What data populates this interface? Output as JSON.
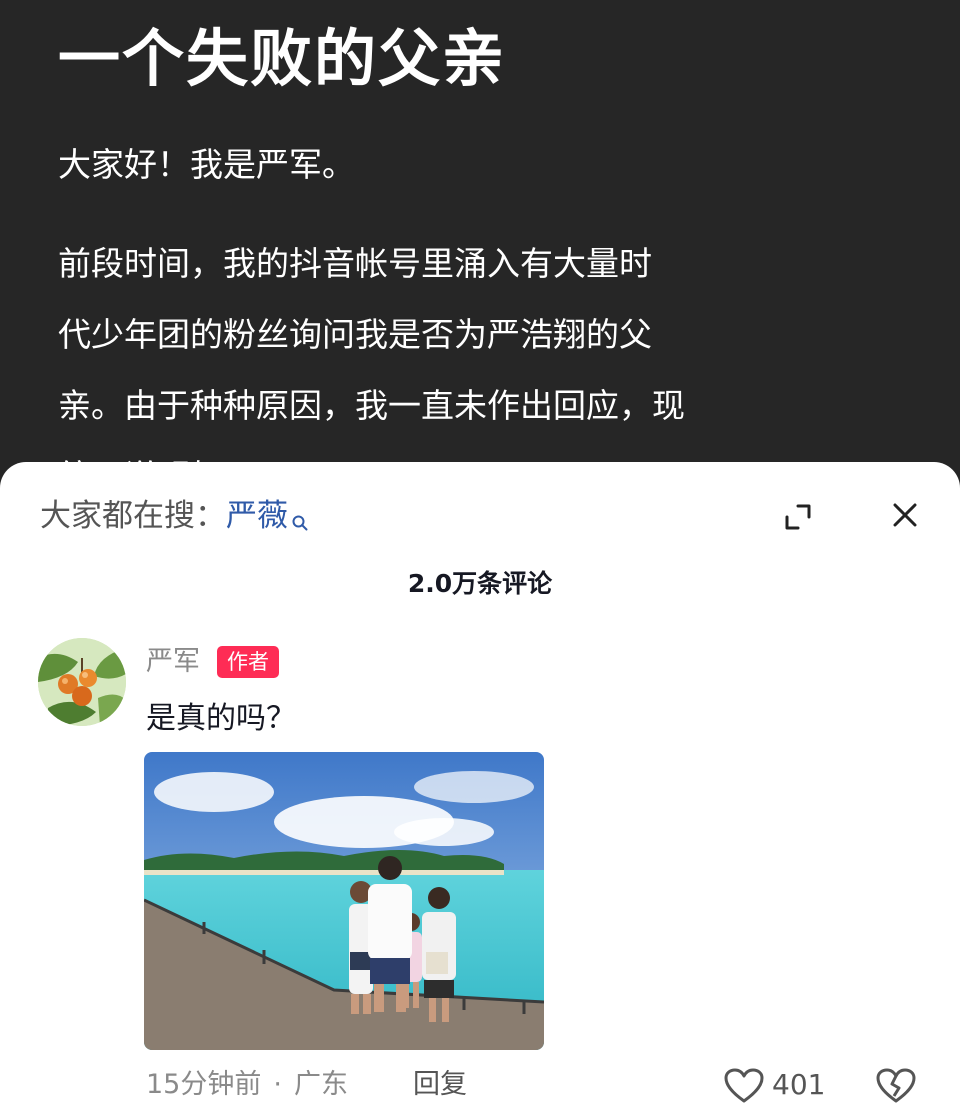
{
  "article": {
    "title": "一个失败的父亲",
    "greeting": "大家好！我是严军。",
    "paragraph_lines": [
      "前段时间，我的抖音帐号里涌入有大量时",
      "代少年团的粉丝询问我是否为严浩翔的父",
      "亲。由于种种原因，我一直未作出回应，现",
      "统一说明如下："
    ]
  },
  "sheet": {
    "search_prefix": "大家都在搜：",
    "search_term": "严薇",
    "comment_count": "2.0万条评论",
    "comment": {
      "author": "严军",
      "badge": "作者",
      "text": "是真的吗？",
      "time": "15分钟前",
      "dot": "·",
      "location": "广东",
      "reply_label": "回复",
      "like_count": "401"
    }
  },
  "icons": {
    "search_mini": "search-icon",
    "expand": "expand-icon",
    "close": "close-icon",
    "like": "heart-icon",
    "dislike": "broken-heart-icon"
  },
  "colors": {
    "article_bg": "#262626",
    "badge": "#fe2c55",
    "search_term": "#2f5aa8"
  }
}
